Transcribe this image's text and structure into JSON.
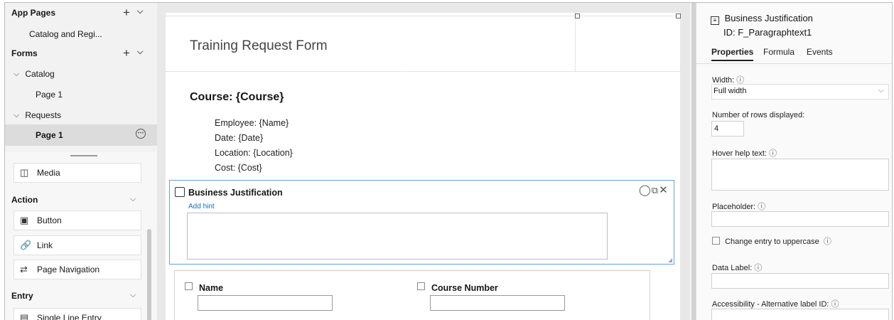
{
  "left_panel": {
    "app_pages": {
      "title": "App Pages",
      "items": [
        "Catalog and Regi..."
      ]
    },
    "forms": {
      "title": "Forms",
      "groups": [
        {
          "label": "Catalog",
          "pages": [
            "Page 1"
          ]
        },
        {
          "label": "Requests",
          "pages": [
            "Page 1"
          ]
        }
      ]
    },
    "media_label": "Media",
    "action": {
      "title": "Action",
      "items": [
        "Button",
        "Link",
        "Page Navigation"
      ]
    },
    "entry": {
      "title": "Entry",
      "items": [
        "Single Line Entry"
      ]
    },
    "icons": {
      "plus": "+",
      "chevron_down": "⌵",
      "chevron_right": "⌵",
      "more": "···"
    }
  },
  "canvas": {
    "form_title": "Training Request Form",
    "course_heading": "Course: {Course}",
    "details": [
      {
        "label": "Employee: ",
        "value": "{Name}"
      },
      {
        "label": "Date: ",
        "value": "{Date}"
      },
      {
        "label": "Location: ",
        "value": "{Location}"
      },
      {
        "label": "Cost: ",
        "value": "{Cost}"
      }
    ],
    "selected_field": {
      "label": "Business Justification",
      "hint": "Add hint"
    },
    "fields": [
      {
        "label": "Name"
      },
      {
        "label": "Course Number"
      }
    ]
  },
  "properties": {
    "title": "Business Justification",
    "id": "ID: F_Paragraphtext1",
    "tabs": [
      "Properties",
      "Formula",
      "Events"
    ],
    "active_tab": "Properties",
    "width_label": "Width: ",
    "width_value": "Full width",
    "rows_label": "Number of rows displayed:",
    "rows_value": "4",
    "hover_label": "Hover help text: ",
    "placeholder_label": "Placeholder: ",
    "uppercase_label": "Change entry to uppercase",
    "data_label_label": "Data Label: ",
    "accessibility_label": "Accessibility - Alternative label ID: ",
    "info_icon": "ⓘ"
  }
}
